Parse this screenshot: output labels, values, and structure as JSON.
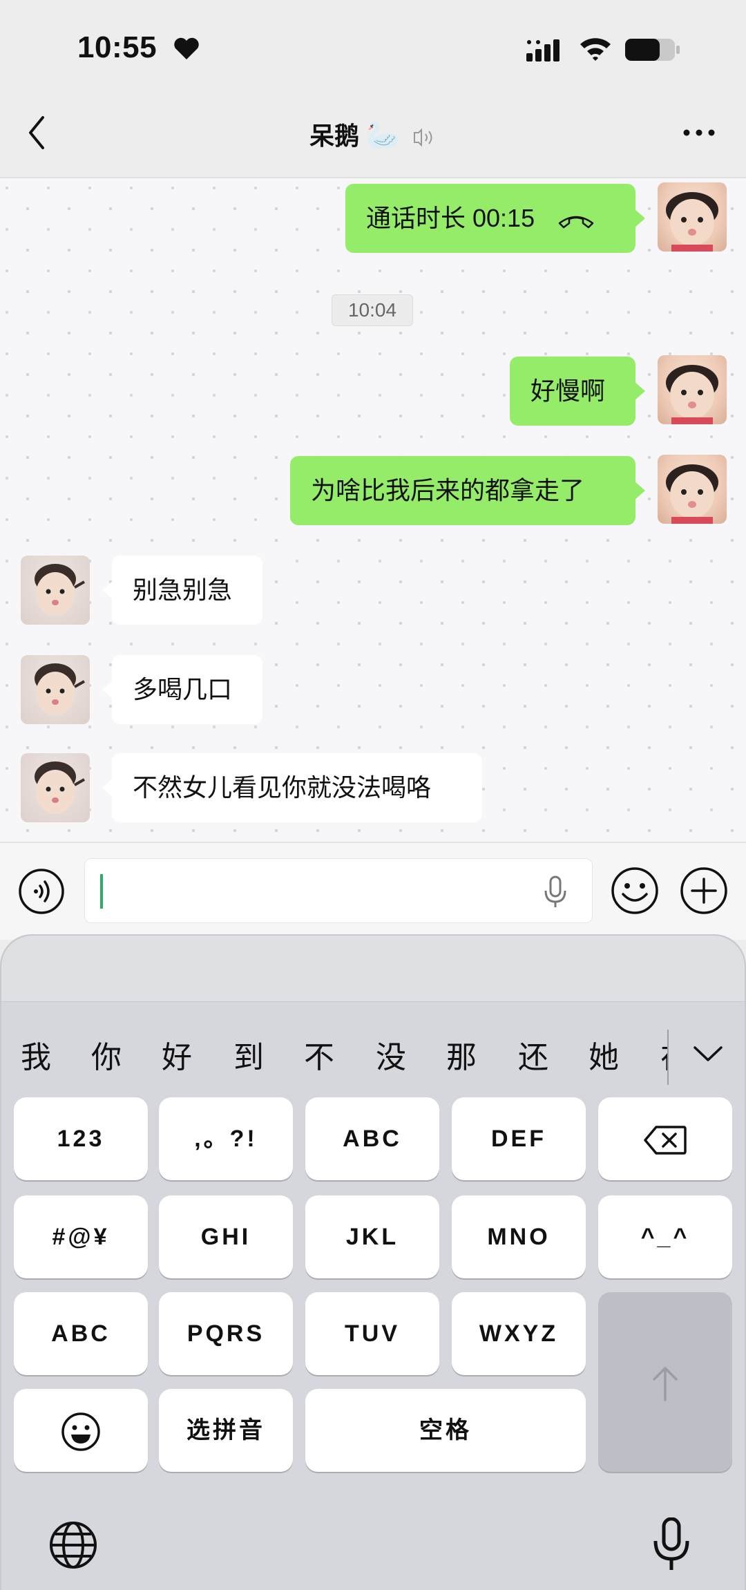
{
  "status_bar": {
    "time": "10:55"
  },
  "nav": {
    "title": "呆鹅",
    "title_emoji": "🦢"
  },
  "messages": [
    {
      "side": "out",
      "text": "通话时长 00:15",
      "kind": "call"
    },
    {
      "side": "out",
      "text": "好慢啊"
    },
    {
      "side": "out",
      "text": "为啥比我后来的都拿走了"
    },
    {
      "side": "in",
      "text": "别急别急"
    },
    {
      "side": "in",
      "text": "多喝几口"
    },
    {
      "side": "in",
      "text": "不然女儿看见你就没法喝咯"
    }
  ],
  "time_divider": "10:04",
  "input": {
    "value": ""
  },
  "keyboard": {
    "candidates": [
      "我",
      "你",
      "好",
      "到",
      "不",
      "没",
      "那",
      "还",
      "她",
      "在"
    ],
    "keys": {
      "num": "123",
      "punct": ",。?!",
      "abc1": "ABC",
      "def": "DEF",
      "sym": "#@¥",
      "ghi": "GHI",
      "jkl": "JKL",
      "mno": "MNO",
      "face": "^_^",
      "abc2": "ABC",
      "pqrs": "PQRS",
      "tuv": "TUV",
      "wxyz": "WXYZ",
      "pinyin": "选拼音",
      "space": "空格"
    }
  },
  "colors": {
    "outgoing_bubble": "#95ec69",
    "incoming_bubble": "#ffffff",
    "accent": "#2aae67"
  }
}
